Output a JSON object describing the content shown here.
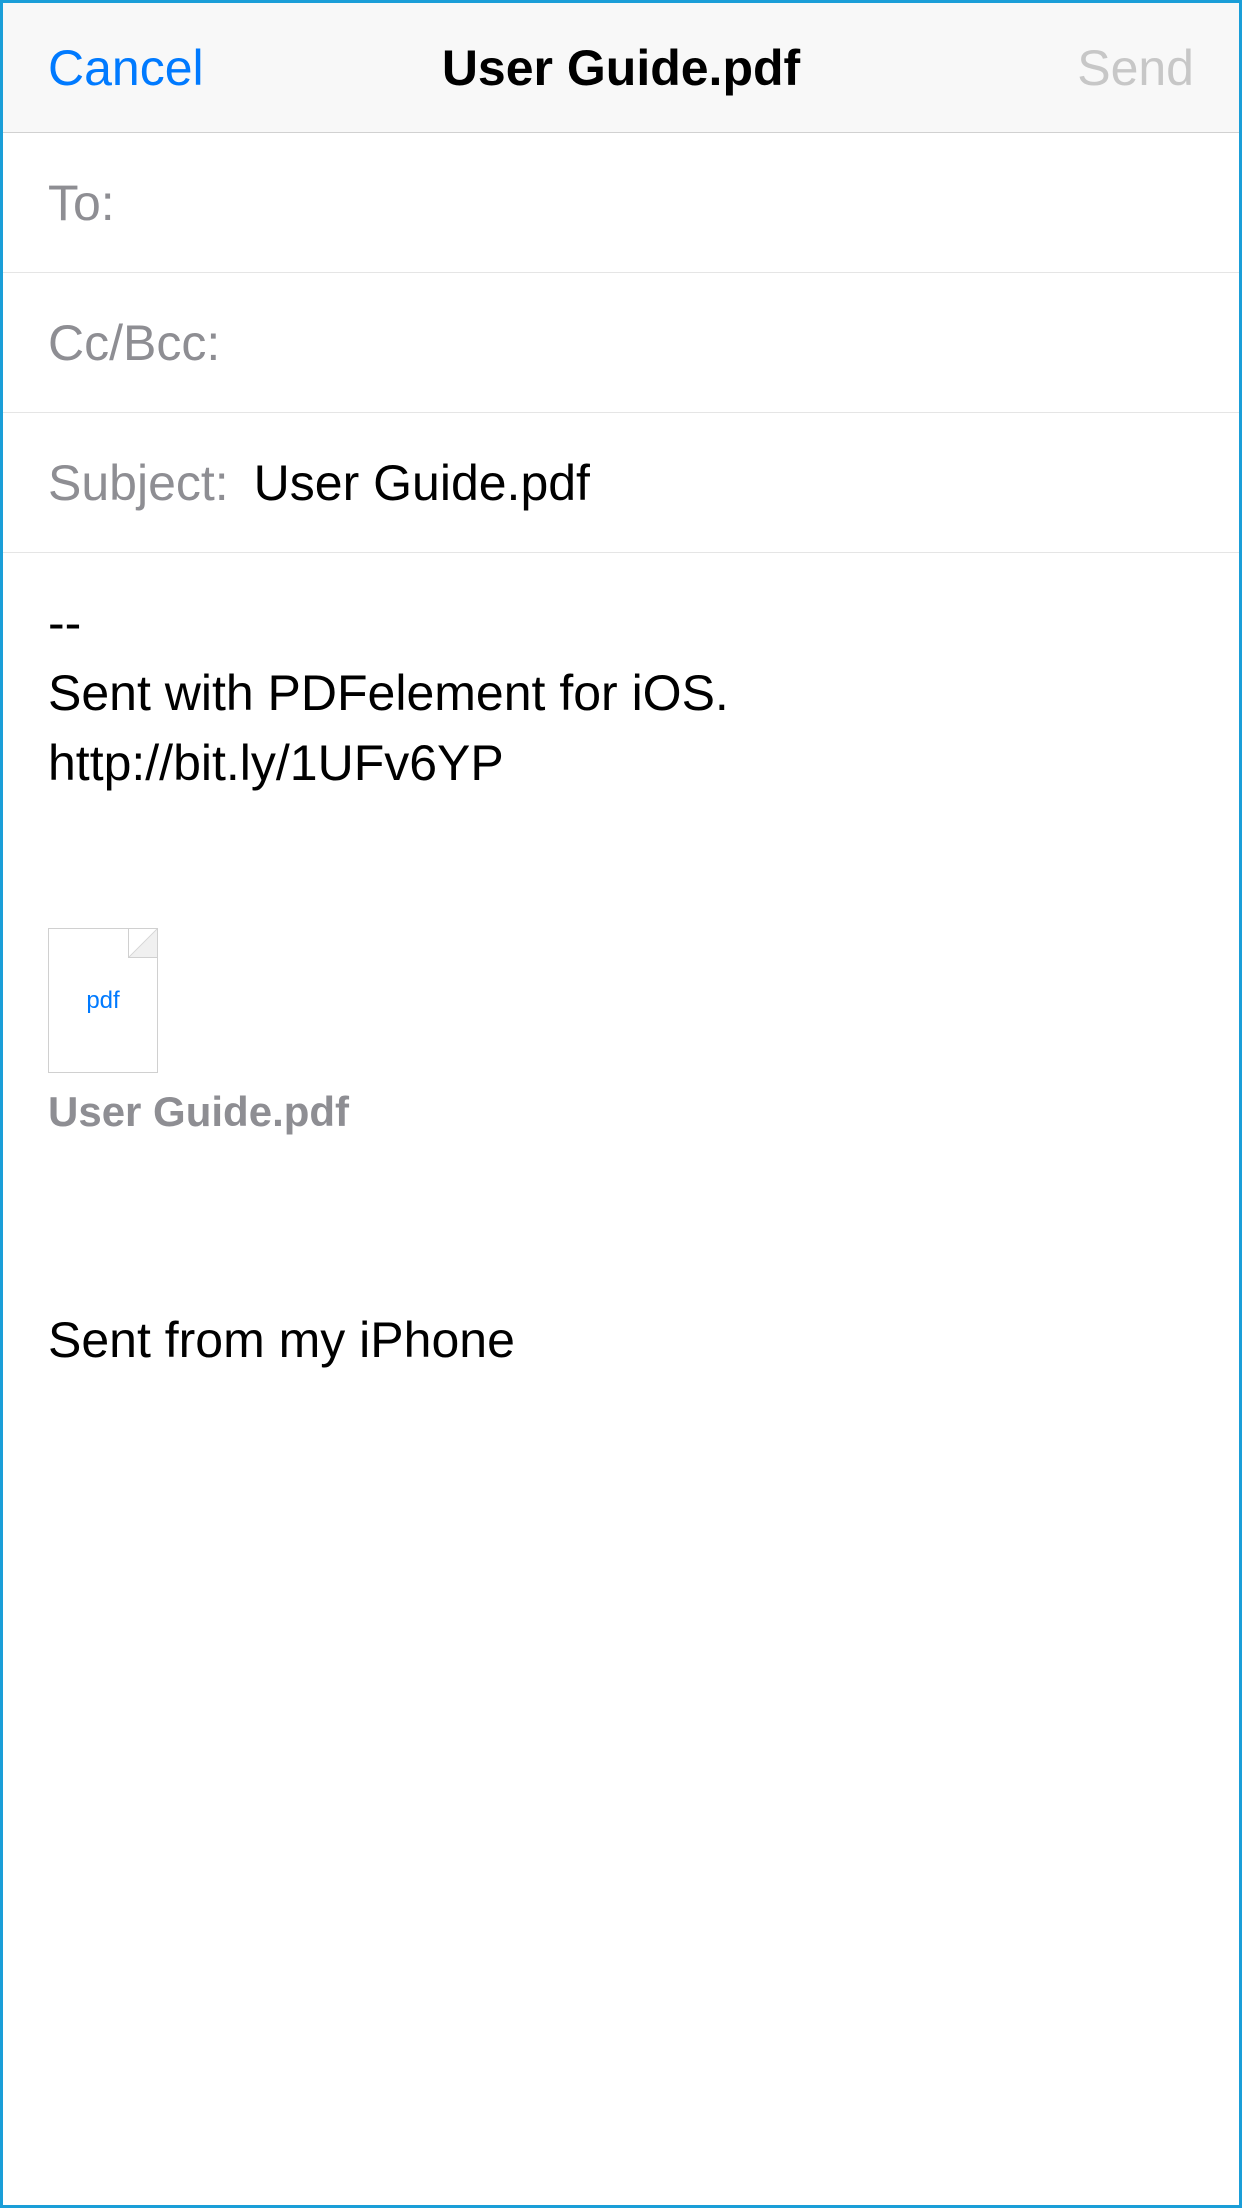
{
  "nav": {
    "cancel": "Cancel",
    "title": "User Guide.pdf",
    "send": "Send"
  },
  "fields": {
    "to_label": "To:",
    "to_value": "",
    "ccbcc_label": "Cc/Bcc:",
    "ccbcc_value": "",
    "subject_label": "Subject:",
    "subject_value": "User Guide.pdf"
  },
  "body": {
    "text": "--\nSent with PDFelement for iOS.\nhttp://bit.ly/1UFv6YP"
  },
  "attachment": {
    "icon_label": "pdf",
    "name": "User Guide.pdf"
  },
  "signature": "Sent from my iPhone"
}
